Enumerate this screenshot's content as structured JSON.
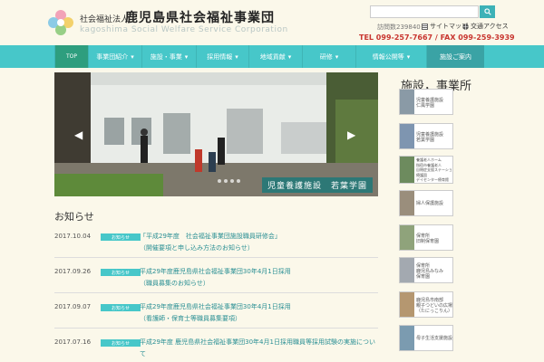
{
  "header": {
    "org_prefix": "社会福祉法人",
    "org_name": "鹿児島県社会福祉事業団",
    "org_en": "kagoshima Social Welfare Service Corporation",
    "search_placeholder": "",
    "counter": "訪問数239840",
    "sitemap_label": "サイトマップ",
    "access_label": "交通アクセス",
    "tel": "TEL 099-257-7667 / FAX 099-259-3939"
  },
  "nav": {
    "top": "TOP",
    "items": [
      {
        "label": "事業団紹介"
      },
      {
        "label": "施設・事業"
      },
      {
        "label": "採用情報"
      },
      {
        "label": "地域貢献"
      },
      {
        "label": "研修"
      },
      {
        "label": "情報公開等"
      },
      {
        "label": "施設ご案内"
      }
    ]
  },
  "hero": {
    "caption": "児童養護施設　若葉学園"
  },
  "news": {
    "title": "お知らせ",
    "items": [
      {
        "date": "2017.10.04",
        "category": "お知らせ",
        "text": "「平成29年度　社会福祉事業団施設職員研修会」\n（開催要項と申し込み方法のお知らせ）"
      },
      {
        "date": "2017.09.26",
        "category": "お知らせ",
        "text": "平成29年度鹿児島県社会福祉事業団30年4月1日採用\n（職員募集のお知らせ）"
      },
      {
        "date": "2017.09.07",
        "category": "お知らせ",
        "text": "平成29年度鹿児島県社会福祉事業団30年4月1日採用\n（看護師・保育士等職員募集要項）"
      },
      {
        "date": "2017.07.16",
        "category": "お知らせ",
        "text": "平成29年度 鹿児島県社会福祉事業団30年4月1日採用職員等採用試験の実施について"
      }
    ]
  },
  "sidebar": {
    "title": "施設，事業所",
    "cards": [
      {
        "label": "児童養護施設\n仁風学園"
      },
      {
        "label": "児童養護施設\n若葉学園"
      },
      {
        "label": "養護老人ホーム\n指宿市養護老人\n自閉症支援ステーション\n療護園\nデイセンター療育館"
      },
      {
        "label": "婦人保護施設"
      },
      {
        "label": "保育所\n旧制保育園"
      },
      {
        "label": "保育所\n鹿児島みなみ\n保育園"
      },
      {
        "label": "鹿児島市南部\n親子つどいの広場\n（たにっこりん）"
      },
      {
        "label": "母子生活支援施設"
      }
    ]
  },
  "colors": {
    "nav": "#47c7c9",
    "accent": "#3db2b7",
    "tel": "#c8352f",
    "background": "#fbf8ea"
  }
}
